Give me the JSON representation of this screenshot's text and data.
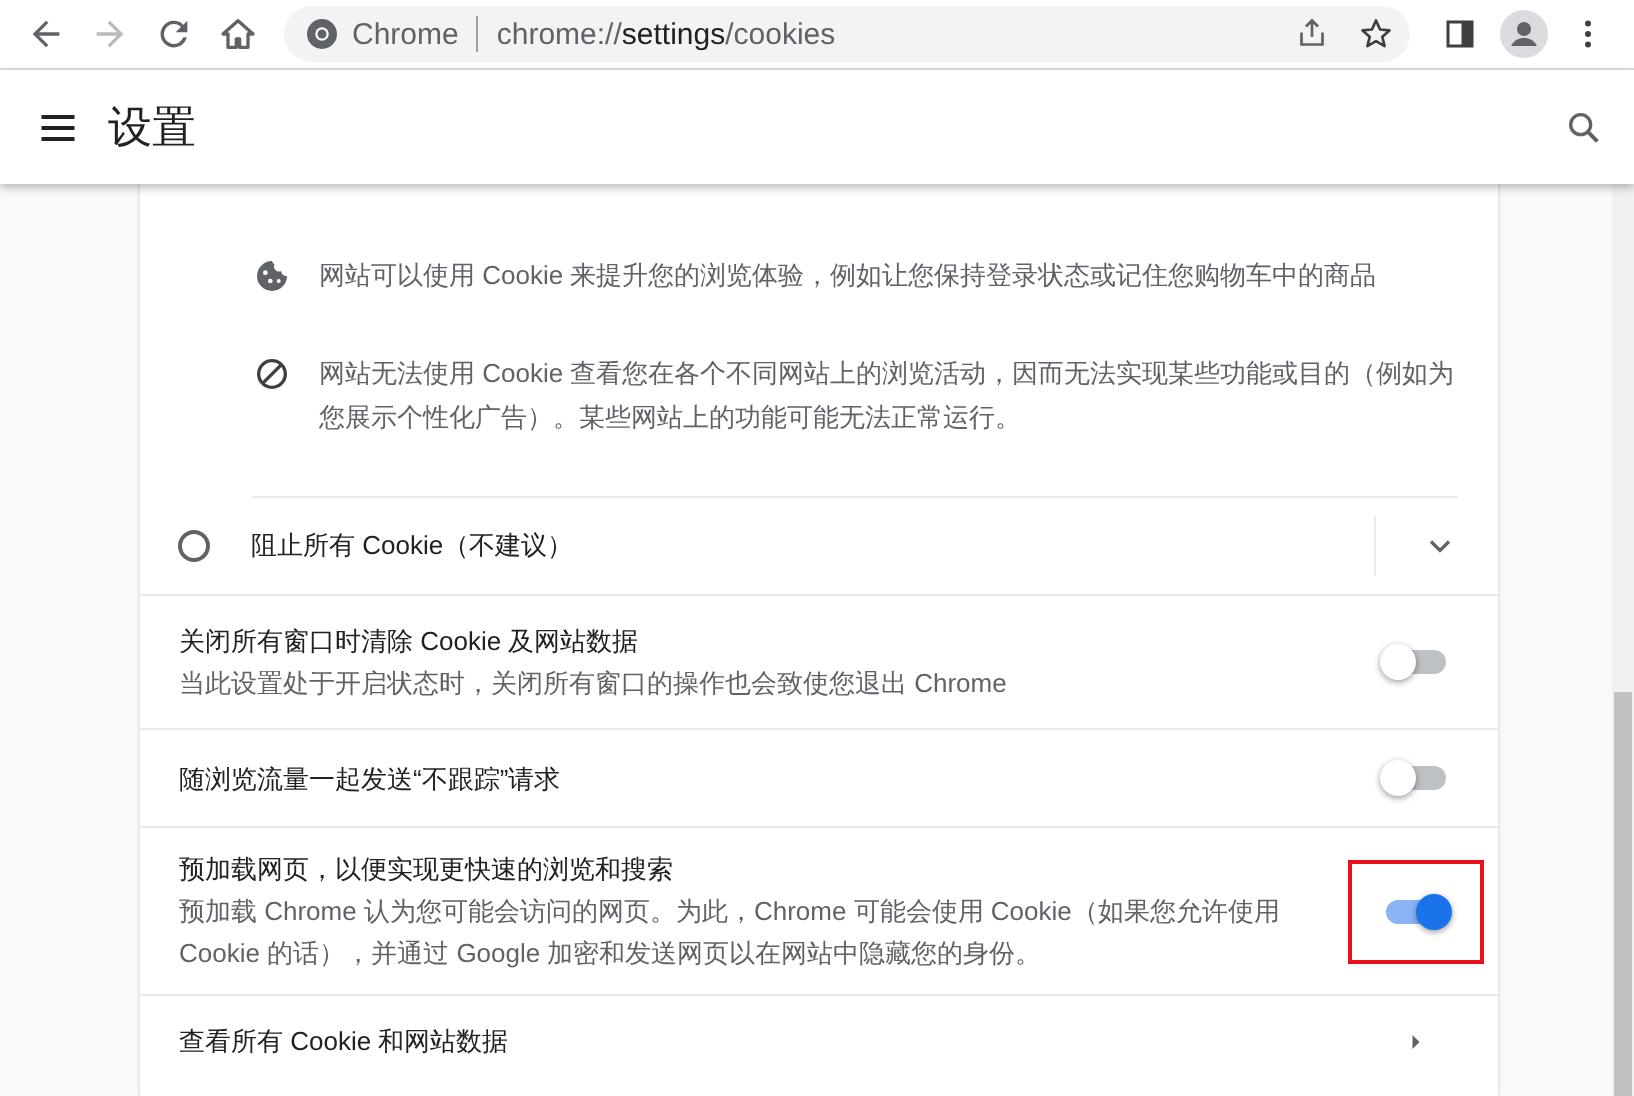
{
  "browser": {
    "forward_disabled": true,
    "site_label": "Chrome",
    "url": {
      "scheme": "chrome://",
      "host": "settings",
      "path": "/cookies"
    }
  },
  "header": {
    "title": "设置"
  },
  "cookie_info": [
    {
      "kind": "cookie",
      "text": "网站可以使用 Cookie 来提升您的浏览体验，例如让您保持登录状态或记住您购物车中的商品"
    },
    {
      "kind": "blocked",
      "text": "网站无法使用 Cookie 查看您在各个不同网站上的浏览活动，因而无法实现某些功能或目的（例如为您展示个性化广告）。某些网站上的功能可能无法正常运行。"
    }
  ],
  "radio_option": {
    "label": "阻止所有 Cookie（不建议）",
    "selected": false
  },
  "settings": [
    {
      "kind": "toggle",
      "label": "关闭所有窗口时清除 Cookie 及网站数据",
      "sublabel": "当此设置处于开启状态时，关闭所有窗口的操作也会致使您退出 Chrome",
      "on": false,
      "highlighted": false
    },
    {
      "kind": "toggle",
      "label": "随浏览流量一起发送“不跟踪”请求",
      "on": false,
      "highlighted": false
    },
    {
      "kind": "toggle",
      "label": "预加载网页，以便实现更快速的浏览和搜索",
      "sublabel": "预加载 Chrome 认为您可能会访问的网页。为此，Chrome 可能会使用 Cookie（如果您允许使用 Cookie 的话），并通过 Google 加密和发送网页以在网站中隐藏您的身份。",
      "on": true,
      "highlighted": true
    },
    {
      "kind": "link",
      "label": "查看所有 Cookie 和网站数据"
    }
  ]
}
